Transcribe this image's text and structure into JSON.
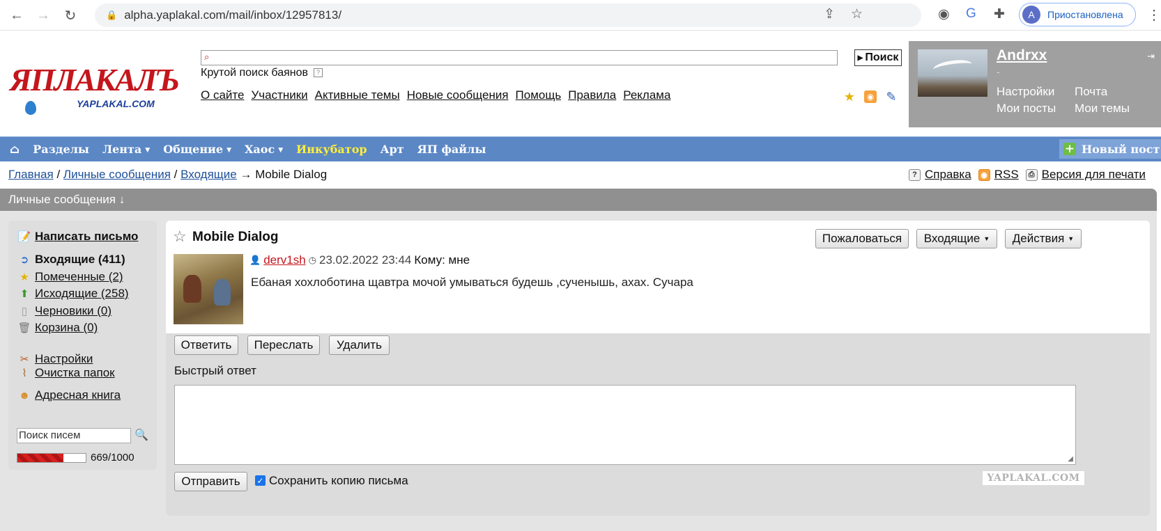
{
  "browser": {
    "url": "alpha.yaplakal.com/mail/inbox/12957813/",
    "profile_initial": "A",
    "profile_label": "Приостановлена"
  },
  "site": {
    "logo_main": "ЯПЛАКАЛЪ",
    "logo_sub": "YAPLAKAL.COM",
    "search_placeholder": "",
    "search_button": "Поиск",
    "cool_search": "Крутой поиск баянов",
    "top_nav": [
      "О сайте",
      "Участники",
      "Активные темы",
      "Новые сообщения",
      "Помощь",
      "Правила",
      "Реклама"
    ]
  },
  "user": {
    "name": "Andrxx",
    "status": "-",
    "links": {
      "settings": "Настройки",
      "mail": "Почта",
      "my_posts": "Мои посты",
      "my_topics": "Мои темы"
    }
  },
  "menu": {
    "items": [
      {
        "label": "Разделы"
      },
      {
        "label": "Лента",
        "dropdown": true
      },
      {
        "label": "Общение",
        "dropdown": true
      },
      {
        "label": "Хаос",
        "dropdown": true
      },
      {
        "label": "Инкубатор",
        "highlight": "#ffef3a"
      },
      {
        "label": "Арт"
      },
      {
        "label": "ЯП файлы"
      }
    ],
    "new_post": "Новый пост"
  },
  "breadcrumb": {
    "home": "Главная",
    "pm": "Личные сообщения",
    "inbox": "Входящие",
    "arrow": "→",
    "current": "Mobile Dialog",
    "sep": "/"
  },
  "tools": {
    "help": "Справка",
    "rss": "RSS",
    "print": "Версия для печати"
  },
  "section_title": "Личные сообщения ↓",
  "sidebar": {
    "compose": "Написать письмо",
    "folders": [
      {
        "label": "Входящие (411)",
        "bold": true,
        "icon": "inbox-icon"
      },
      {
        "label": "Помеченные (2)",
        "icon": "star-icon"
      },
      {
        "label": "Исходящие (258)",
        "icon": "outbox-icon"
      },
      {
        "label": "Черновики (0)",
        "icon": "draft-icon"
      },
      {
        "label": "Корзина (0)",
        "icon": "trash-icon"
      }
    ],
    "settings": "Настройки",
    "cleanup": "Очистка папок",
    "address_book": "Адресная книга",
    "search_value": "Поиск писем",
    "quota_text": "669/1000",
    "quota_fraction": 0.669
  },
  "message": {
    "title": "Mobile Dialog",
    "buttons": {
      "report": "Пожаловаться",
      "inbox": "Входящие",
      "actions": "Действия"
    },
    "author": "derv1sh",
    "date": "23.02.2022 23:44",
    "to": "Кому: мне",
    "body": "Ебаная хохлоботина щавтра мочой умываться будешь ,сученышь, ахах. Сучара"
  },
  "reply": {
    "answer": "Ответить",
    "forward": "Переслать",
    "delete": "Удалить",
    "quick_reply_label": "Быстрый ответ",
    "send": "Отправить",
    "save_copy": "Сохранить копию письма",
    "save_copy_checked": true
  },
  "watermark": "YAPLAKAL.COM",
  "colors": {
    "menu_bg": "#5b87c5",
    "brand_red": "#c4161c",
    "section_header": "#909090"
  }
}
